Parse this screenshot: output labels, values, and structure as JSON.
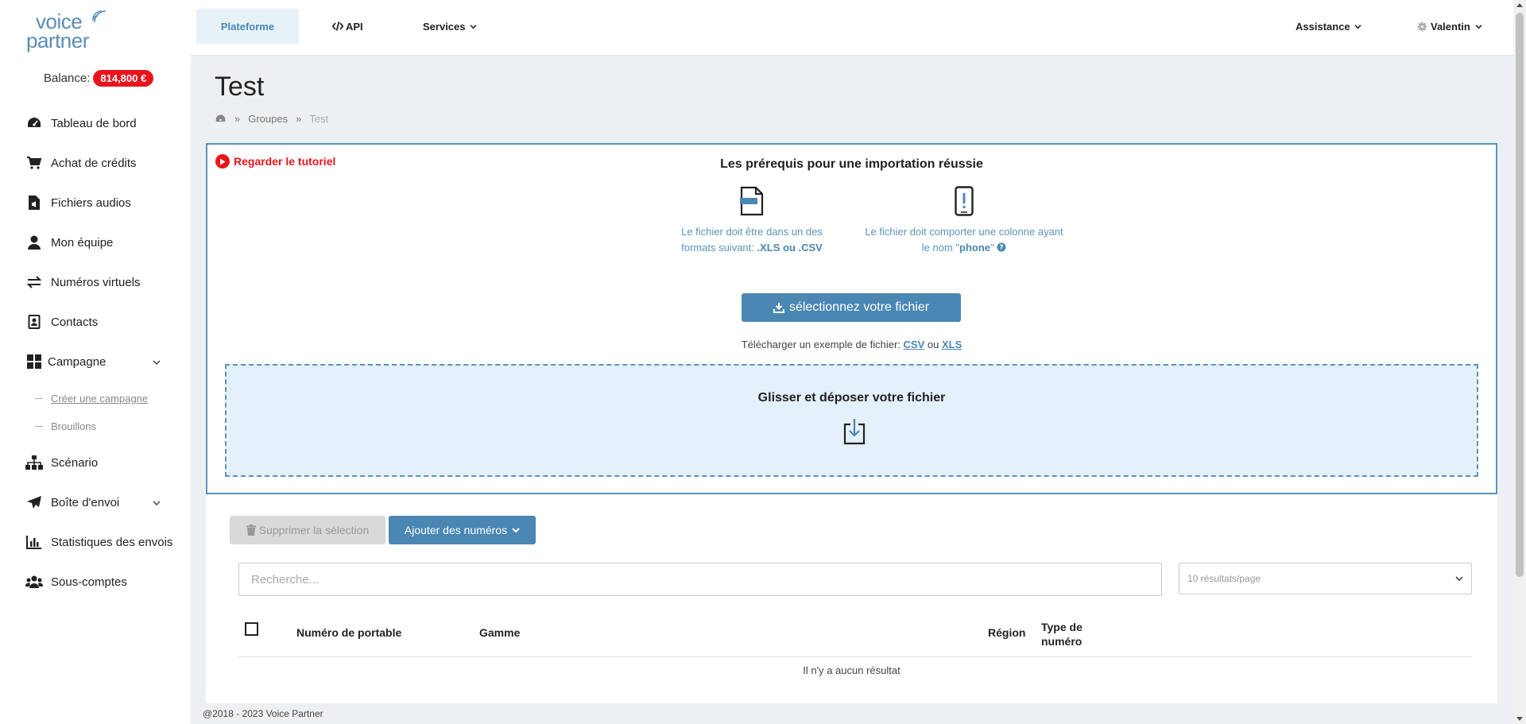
{
  "brand": {
    "line1": "voice",
    "line2": "partner"
  },
  "balance": {
    "label": "Balance:",
    "amount": "814,800 €"
  },
  "sidebar": {
    "items": [
      {
        "label": "Tableau de bord",
        "icon": "dashboard-icon"
      },
      {
        "label": "Achat de crédits",
        "icon": "cart-icon"
      },
      {
        "label": "Fichiers audios",
        "icon": "audio-file-icon"
      },
      {
        "label": "Mon équipe",
        "icon": "user-icon"
      },
      {
        "label": "Numéros virtuels",
        "icon": "exchange-icon"
      },
      {
        "label": "Contacts",
        "icon": "address-book-icon"
      },
      {
        "label": "Campagne",
        "icon": "grid-icon"
      },
      {
        "label": "Scénario",
        "icon": "sitemap-icon"
      },
      {
        "label": "Boîte d'envoi",
        "icon": "paper-plane-icon"
      },
      {
        "label": "Statistiques des envois",
        "icon": "bar-chart-icon"
      },
      {
        "label": "Sous-comptes",
        "icon": "users-icon"
      }
    ],
    "campagne_sub": [
      {
        "label": "Créer une campagne"
      },
      {
        "label": "Brouillons"
      }
    ]
  },
  "topbar": {
    "plateforme": "Plateforme",
    "api": "API",
    "services": "Services",
    "assistance": "Assistance",
    "user": "Valentin"
  },
  "page": {
    "title": "Test",
    "breadcrumb": {
      "sep": "»",
      "groupes": "Groupes",
      "current": "Test"
    }
  },
  "import": {
    "tutorial": "Regarder le tutoriel",
    "title": "Les prérequis pour une importation réussie",
    "req1_text": "Le fichier doit être dans un des formats suivant:",
    "req1_bold": ".XLS ou .CSV",
    "req2_text": "Le fichier doit comporter une colonne ayant le nom \"",
    "req2_bold": "phone",
    "req2_end": "\"",
    "select_button": "sélectionnez votre fichier",
    "download_text": "Télécharger un exemple de fichier:",
    "csv": "CSV",
    "or": "ou",
    "xls": "XLS",
    "dropzone": "Glisser et déposer votre fichier"
  },
  "table": {
    "delete_button": "Supprimer la sélection",
    "add_button": "Ajouter des numéros",
    "search_placeholder": "Recherche...",
    "per_page": "10 résultats/page",
    "columns": {
      "numero": "Numéro de portable",
      "gamme": "Gamme",
      "region": "Région",
      "type_line1": "Type de",
      "type_line2": "numéro"
    },
    "empty": "Il n'y a aucun résultat"
  },
  "footer": "@2018 - 2023 Voice Partner",
  "colors": {
    "accent": "#4a87b3",
    "danger": "#e8141d",
    "background": "#edf0f2"
  }
}
